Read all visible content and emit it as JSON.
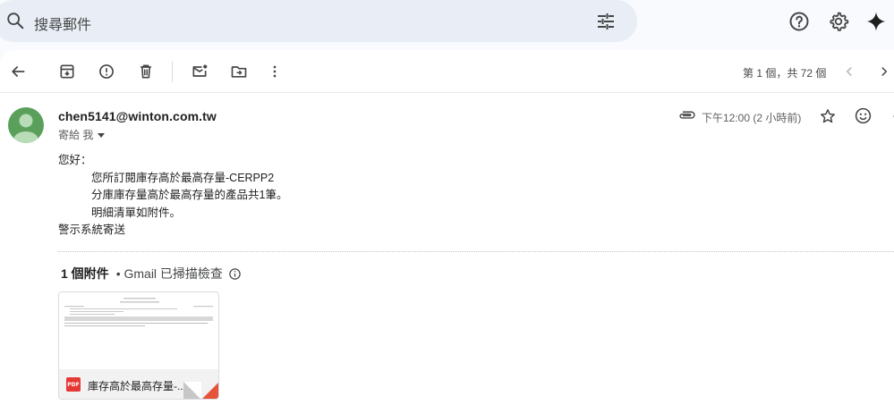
{
  "search": {
    "placeholder": "搜尋郵件"
  },
  "header_icons": [
    "search-icon",
    "tune-icon",
    "help-icon",
    "settings-icon",
    "gemini-sparkle-icon"
  ],
  "toolbar": {
    "icons": [
      "back-arrow-icon",
      "archive-icon",
      "report-spam-icon",
      "delete-icon",
      "mark-unread-icon",
      "move-to-icon",
      "more-options-icon"
    ],
    "pager_text": "第 1 個，共 72 個"
  },
  "message": {
    "sender": "chen5141@winton.com.tw",
    "to_line": "寄給 我",
    "time": "下午12:00 (2 小時前)",
    "body": {
      "greeting": "您好：",
      "line1": "您所訂閱庫存高於最高存量-CERPP2",
      "line2": "分庫庫存量高於最高存量的產品共1筆。",
      "line3": "明細清單如附件。",
      "signoff": "警示系統寄送"
    }
  },
  "attachments": {
    "count_label": "1 個附件",
    "scan_label": "• Gmail 已掃描檢查",
    "items": [
      {
        "type": "PDF",
        "name": "庫存高於最高存量-..."
      }
    ]
  },
  "colors": {
    "avatar": "#5aa05b",
    "pdf": "#e53935",
    "search_bg": "#e9eef6"
  }
}
